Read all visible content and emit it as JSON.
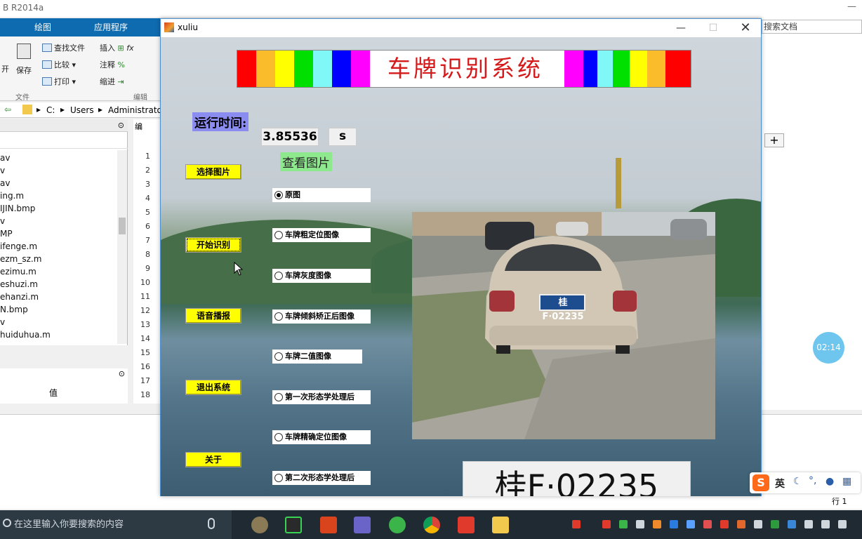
{
  "matlab": {
    "title": "B R2014a",
    "tabs": [
      "绘图",
      "应用程序"
    ],
    "ribbon": {
      "find_files": "查找文件",
      "compare": "比较",
      "print": "打印",
      "save": "保存",
      "open": "开",
      "insert": "插入",
      "comment": "注释",
      "indent": "缩进",
      "group_file": "文件",
      "group_edit": "编辑"
    },
    "address": [
      "C:",
      "Users",
      "Administrato"
    ],
    "search_placeholder": "搜索文档",
    "files": [
      "av",
      "v",
      "av",
      "ing.m",
      "IJIN.bmp",
      "v",
      "MP",
      "ifenge.m",
      "ezm_sz.m",
      "ezimu.m",
      "eshuzi.m",
      "ehanzi.m",
      "N.bmp",
      "v",
      "huiduhua.m"
    ],
    "editor_tab": "编",
    "line_numbers": [
      "1",
      "2",
      "3",
      "4",
      "5",
      "6",
      "7",
      "8",
      "9",
      "10",
      "11",
      "12",
      "13",
      "14",
      "15",
      "16",
      "17",
      "18"
    ],
    "workspace_value_header": "值",
    "status_row": "行 1"
  },
  "gui": {
    "window_title": "xuliu",
    "banner_title": "车牌识别系统",
    "stripe_colors_left": [
      "#ff0000",
      "#fbbc2b",
      "#ffff00",
      "#00e000",
      "#80f8f8",
      "#0000ff",
      "#ff00ff"
    ],
    "stripe_colors_right": [
      "#ff00ff",
      "#0000ff",
      "#80f8f8",
      "#00e000",
      "#ffff00",
      "#fbbc2b",
      "#ff0000"
    ],
    "runtime_label": "运行时间:",
    "runtime_value": "3.85536",
    "runtime_unit": "s",
    "view_image_label": "查看图片",
    "buttons": {
      "select_image": "选择图片",
      "start_recognition": "开始识别",
      "voice_broadcast": "语音播报",
      "exit_system": "退出系统",
      "about": "关于"
    },
    "radios": [
      {
        "label": "原图",
        "selected": true
      },
      {
        "label": "车牌粗定位图像",
        "selected": false
      },
      {
        "label": "车牌灰度图像",
        "selected": false
      },
      {
        "label": "车牌倾斜矫正后图像",
        "selected": false
      },
      {
        "label": "车牌二值图像",
        "selected": false
      },
      {
        "label": "第一次形态学处理后",
        "selected": false
      },
      {
        "label": "车牌精确定位图像",
        "selected": false
      },
      {
        "label": "第二次形态学处理后",
        "selected": false
      }
    ],
    "plate_on_car": "桂F·02235",
    "result_plate": "桂F·02235"
  },
  "taskbar": {
    "search_placeholder": "在这里输入你要搜索的内容",
    "clock_bubble": "02:14",
    "ime_lang": "英"
  }
}
